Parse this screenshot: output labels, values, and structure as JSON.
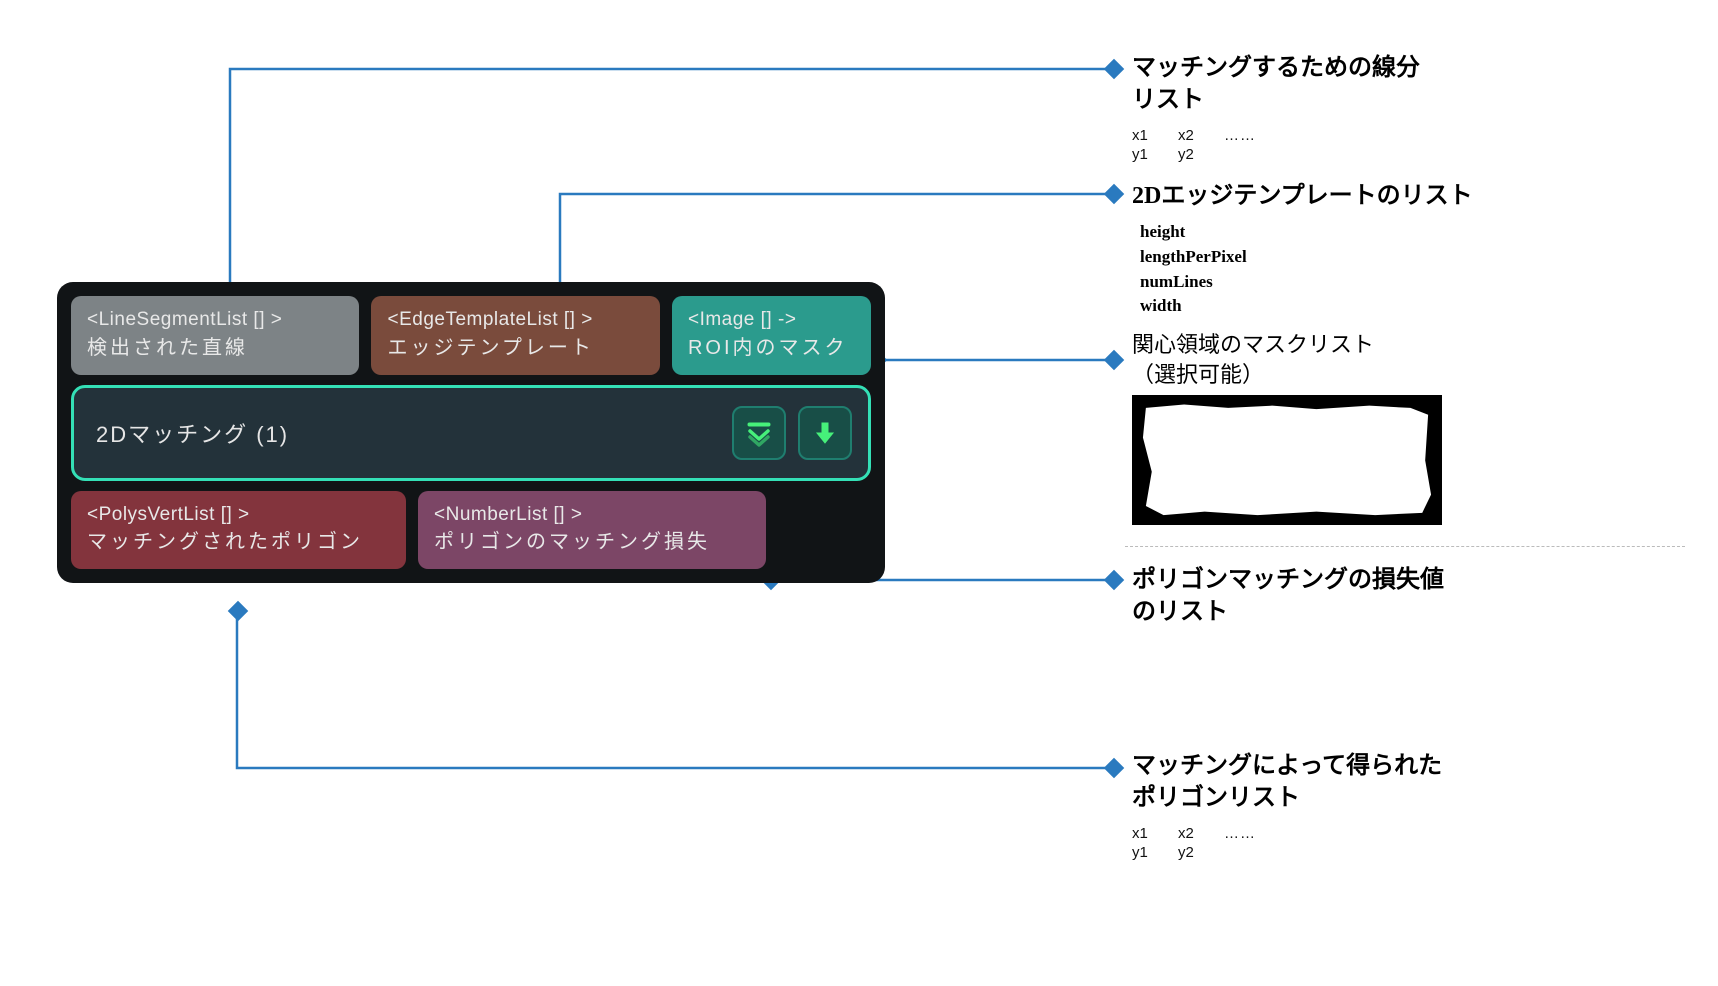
{
  "node": {
    "inputs": [
      {
        "type": "<LineSegmentList [] >",
        "label": "検出された直線"
      },
      {
        "type": "<EdgeTemplateList [] >",
        "label": "エッジテンプレート"
      },
      {
        "type": "<Image [] ->",
        "label": "ROI内のマスク"
      }
    ],
    "title": "2Dマッチング (1)",
    "outputs": [
      {
        "type": "<PolysVertList [] >",
        "label": "マッチングされたポリゴン"
      },
      {
        "type": "<NumberList [] >",
        "label": "ポリゴンのマッチング損失"
      }
    ]
  },
  "callouts": {
    "c1": {
      "t1": "マッチングするための線分",
      "t2": "リスト",
      "cols": [
        "x1",
        "x2",
        "……"
      ],
      "rows": [
        "y1",
        "y2"
      ]
    },
    "c2": {
      "t1": "2Dエッジテンプレートのリスト",
      "fields": [
        "height",
        "lengthPerPixel",
        "numLines",
        "width"
      ]
    },
    "c3": {
      "t1": "関心領域のマスクリスト",
      "t2": "（選択可能）"
    },
    "c4": {
      "t1": "ポリゴンマッチングの損失値",
      "t2": "のリスト"
    },
    "c5": {
      "t1": "マッチングによって得られた",
      "t2": "ポリゴンリスト",
      "cols": [
        "x1",
        "x2",
        "……"
      ],
      "rows": [
        "y1",
        "y2"
      ]
    }
  }
}
